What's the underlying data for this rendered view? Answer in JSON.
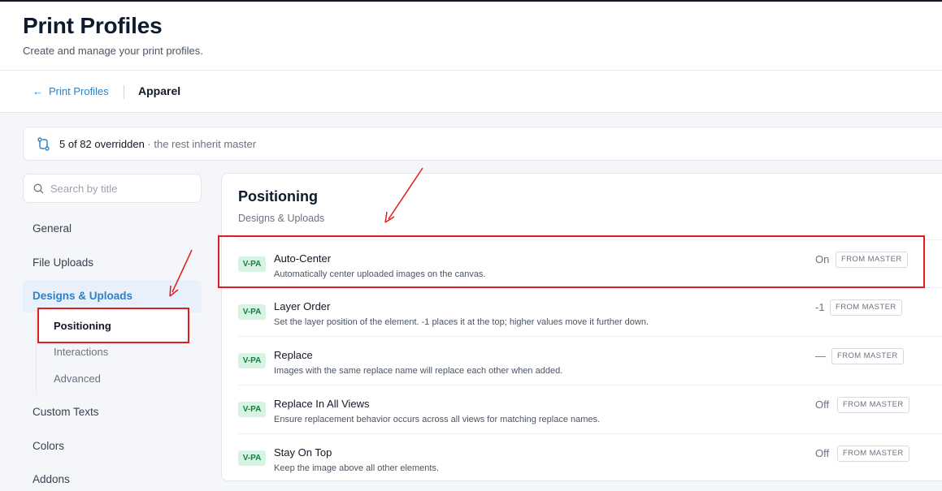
{
  "header": {
    "title": "Print Profiles",
    "subtitle": "Create and manage your print profiles."
  },
  "breadcrumb": {
    "back_label": "Print Profiles",
    "current": "Apparel"
  },
  "banner": {
    "count": "5 of 82 overridden",
    "rest": " · the rest inherit master",
    "icon": "git-compare-icon"
  },
  "search": {
    "placeholder": "Search by title"
  },
  "sidebar": {
    "items": [
      {
        "label": "General"
      },
      {
        "label": "File Uploads"
      },
      {
        "label": "Designs & Uploads",
        "active": true
      },
      {
        "label": "Custom Texts"
      },
      {
        "label": "Colors"
      },
      {
        "label": "Addons"
      }
    ],
    "subitems": [
      {
        "label": "Positioning",
        "selected": true
      },
      {
        "label": "Interactions"
      },
      {
        "label": "Advanced"
      }
    ]
  },
  "panel": {
    "title": "Positioning",
    "subtitle": "Designs & Uploads",
    "rows": [
      {
        "badge": "V-PA",
        "name": "Auto-Center",
        "desc": "Automatically center uploaded images on the canvas.",
        "value": "On",
        "tag": "FROM MASTER"
      },
      {
        "badge": "V-PA",
        "name": "Layer Order",
        "desc": "Set the layer position of the element. -1 places it at the top; higher values move it further down.",
        "value": "-1",
        "tag": "FROM MASTER"
      },
      {
        "badge": "V-PA",
        "name": "Replace",
        "desc": "Images with the same replace name will replace each other when added.",
        "value": "—",
        "tag": "FROM MASTER"
      },
      {
        "badge": "V-PA",
        "name": "Replace In All Views",
        "desc": "Ensure replacement behavior occurs across all views for matching replace names.",
        "value": "Off",
        "tag": "FROM MASTER"
      },
      {
        "badge": "V-PA",
        "name": "Stay On Top",
        "desc": "Keep the image above all other elements.",
        "value": "Off",
        "tag": "FROM MASTER"
      }
    ]
  },
  "colors": {
    "accent": "#2f80c4",
    "badge_bg": "#d7f3e3",
    "badge_text": "#15803d",
    "annotation": "#e11d1d"
  }
}
